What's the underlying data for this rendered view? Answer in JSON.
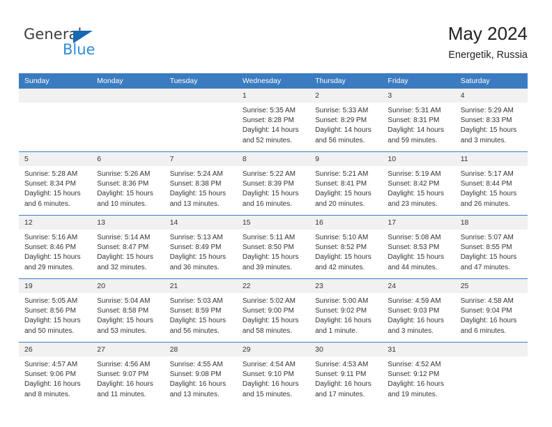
{
  "logo": {
    "word_top": "General",
    "word_bottom": "Blue",
    "triangle_icon": "triangle-icon",
    "brand_blue": "#2e8bd8",
    "triangle_blue": "#1668b3"
  },
  "header": {
    "title": "May 2024",
    "location": "Energetik, Russia"
  },
  "theme": {
    "header_blue": "#3b7cc0",
    "daynum_band": "#f1f1f1",
    "text": "#333333"
  },
  "weekdays": [
    "Sunday",
    "Monday",
    "Tuesday",
    "Wednesday",
    "Thursday",
    "Friday",
    "Saturday"
  ],
  "weeks": [
    [
      {
        "day": "",
        "empty": true
      },
      {
        "day": "",
        "empty": true
      },
      {
        "day": "",
        "empty": true
      },
      {
        "day": "1",
        "sunrise": "Sunrise: 5:35 AM",
        "sunset": "Sunset: 8:28 PM",
        "daylight": "Daylight: 14 hours and 52 minutes."
      },
      {
        "day": "2",
        "sunrise": "Sunrise: 5:33 AM",
        "sunset": "Sunset: 8:29 PM",
        "daylight": "Daylight: 14 hours and 56 minutes."
      },
      {
        "day": "3",
        "sunrise": "Sunrise: 5:31 AM",
        "sunset": "Sunset: 8:31 PM",
        "daylight": "Daylight: 14 hours and 59 minutes."
      },
      {
        "day": "4",
        "sunrise": "Sunrise: 5:29 AM",
        "sunset": "Sunset: 8:33 PM",
        "daylight": "Daylight: 15 hours and 3 minutes."
      }
    ],
    [
      {
        "day": "5",
        "sunrise": "Sunrise: 5:28 AM",
        "sunset": "Sunset: 8:34 PM",
        "daylight": "Daylight: 15 hours and 6 minutes."
      },
      {
        "day": "6",
        "sunrise": "Sunrise: 5:26 AM",
        "sunset": "Sunset: 8:36 PM",
        "daylight": "Daylight: 15 hours and 10 minutes."
      },
      {
        "day": "7",
        "sunrise": "Sunrise: 5:24 AM",
        "sunset": "Sunset: 8:38 PM",
        "daylight": "Daylight: 15 hours and 13 minutes."
      },
      {
        "day": "8",
        "sunrise": "Sunrise: 5:22 AM",
        "sunset": "Sunset: 8:39 PM",
        "daylight": "Daylight: 15 hours and 16 minutes."
      },
      {
        "day": "9",
        "sunrise": "Sunrise: 5:21 AM",
        "sunset": "Sunset: 8:41 PM",
        "daylight": "Daylight: 15 hours and 20 minutes."
      },
      {
        "day": "10",
        "sunrise": "Sunrise: 5:19 AM",
        "sunset": "Sunset: 8:42 PM",
        "daylight": "Daylight: 15 hours and 23 minutes."
      },
      {
        "day": "11",
        "sunrise": "Sunrise: 5:17 AM",
        "sunset": "Sunset: 8:44 PM",
        "daylight": "Daylight: 15 hours and 26 minutes."
      }
    ],
    [
      {
        "day": "12",
        "sunrise": "Sunrise: 5:16 AM",
        "sunset": "Sunset: 8:46 PM",
        "daylight": "Daylight: 15 hours and 29 minutes."
      },
      {
        "day": "13",
        "sunrise": "Sunrise: 5:14 AM",
        "sunset": "Sunset: 8:47 PM",
        "daylight": "Daylight: 15 hours and 32 minutes."
      },
      {
        "day": "14",
        "sunrise": "Sunrise: 5:13 AM",
        "sunset": "Sunset: 8:49 PM",
        "daylight": "Daylight: 15 hours and 36 minutes."
      },
      {
        "day": "15",
        "sunrise": "Sunrise: 5:11 AM",
        "sunset": "Sunset: 8:50 PM",
        "daylight": "Daylight: 15 hours and 39 minutes."
      },
      {
        "day": "16",
        "sunrise": "Sunrise: 5:10 AM",
        "sunset": "Sunset: 8:52 PM",
        "daylight": "Daylight: 15 hours and 42 minutes."
      },
      {
        "day": "17",
        "sunrise": "Sunrise: 5:08 AM",
        "sunset": "Sunset: 8:53 PM",
        "daylight": "Daylight: 15 hours and 44 minutes."
      },
      {
        "day": "18",
        "sunrise": "Sunrise: 5:07 AM",
        "sunset": "Sunset: 8:55 PM",
        "daylight": "Daylight: 15 hours and 47 minutes."
      }
    ],
    [
      {
        "day": "19",
        "sunrise": "Sunrise: 5:05 AM",
        "sunset": "Sunset: 8:56 PM",
        "daylight": "Daylight: 15 hours and 50 minutes."
      },
      {
        "day": "20",
        "sunrise": "Sunrise: 5:04 AM",
        "sunset": "Sunset: 8:58 PM",
        "daylight": "Daylight: 15 hours and 53 minutes."
      },
      {
        "day": "21",
        "sunrise": "Sunrise: 5:03 AM",
        "sunset": "Sunset: 8:59 PM",
        "daylight": "Daylight: 15 hours and 56 minutes."
      },
      {
        "day": "22",
        "sunrise": "Sunrise: 5:02 AM",
        "sunset": "Sunset: 9:00 PM",
        "daylight": "Daylight: 15 hours and 58 minutes."
      },
      {
        "day": "23",
        "sunrise": "Sunrise: 5:00 AM",
        "sunset": "Sunset: 9:02 PM",
        "daylight": "Daylight: 16 hours and 1 minute."
      },
      {
        "day": "24",
        "sunrise": "Sunrise: 4:59 AM",
        "sunset": "Sunset: 9:03 PM",
        "daylight": "Daylight: 16 hours and 3 minutes."
      },
      {
        "day": "25",
        "sunrise": "Sunrise: 4:58 AM",
        "sunset": "Sunset: 9:04 PM",
        "daylight": "Daylight: 16 hours and 6 minutes."
      }
    ],
    [
      {
        "day": "26",
        "sunrise": "Sunrise: 4:57 AM",
        "sunset": "Sunset: 9:06 PM",
        "daylight": "Daylight: 16 hours and 8 minutes."
      },
      {
        "day": "27",
        "sunrise": "Sunrise: 4:56 AM",
        "sunset": "Sunset: 9:07 PM",
        "daylight": "Daylight: 16 hours and 11 minutes."
      },
      {
        "day": "28",
        "sunrise": "Sunrise: 4:55 AM",
        "sunset": "Sunset: 9:08 PM",
        "daylight": "Daylight: 16 hours and 13 minutes."
      },
      {
        "day": "29",
        "sunrise": "Sunrise: 4:54 AM",
        "sunset": "Sunset: 9:10 PM",
        "daylight": "Daylight: 16 hours and 15 minutes."
      },
      {
        "day": "30",
        "sunrise": "Sunrise: 4:53 AM",
        "sunset": "Sunset: 9:11 PM",
        "daylight": "Daylight: 16 hours and 17 minutes."
      },
      {
        "day": "31",
        "sunrise": "Sunrise: 4:52 AM",
        "sunset": "Sunset: 9:12 PM",
        "daylight": "Daylight: 16 hours and 19 minutes."
      },
      {
        "day": "",
        "empty": true
      }
    ]
  ]
}
